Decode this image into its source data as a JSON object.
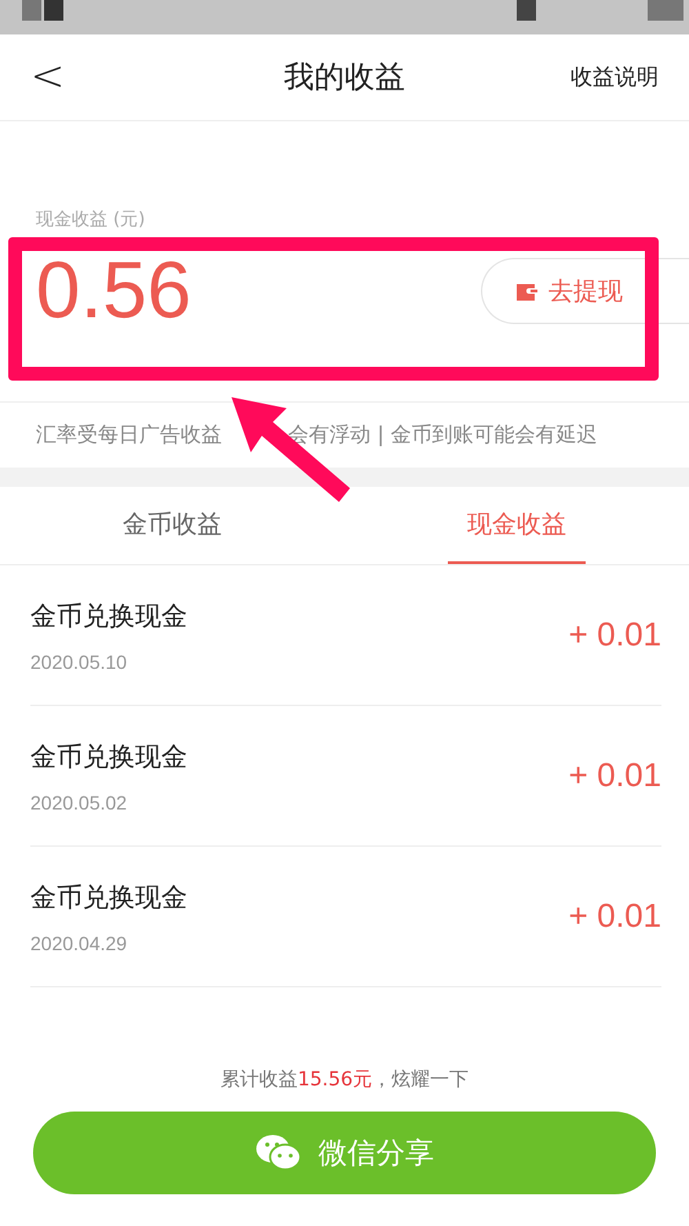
{
  "header": {
    "back": "<",
    "title": "我的收益",
    "link": "收益说明"
  },
  "balance": {
    "label": "现金收益 (元)",
    "amount": "0.56",
    "button": "去提现"
  },
  "note": {
    "before": "汇率受每日广告收益",
    "after": "会有浮动 | 金币到账可能会有延迟"
  },
  "tabs": [
    {
      "label": "金币收益",
      "selected": false
    },
    {
      "label": "现金收益",
      "selected": true
    }
  ],
  "records": [
    {
      "title": "金币兑换现金",
      "date": "2020.05.10",
      "amount": "+ 0.01"
    },
    {
      "title": "金币兑换现金",
      "date": "2020.05.02",
      "amount": "+ 0.01"
    },
    {
      "title": "金币兑换现金",
      "date": "2020.04.29",
      "amount": "+ 0.01"
    }
  ],
  "footer": {
    "summary": "累计收益**15.56元**，炫耀一下",
    "share_button": "微信分享"
  },
  "annotation": {
    "kind": "box-arrow"
  }
}
